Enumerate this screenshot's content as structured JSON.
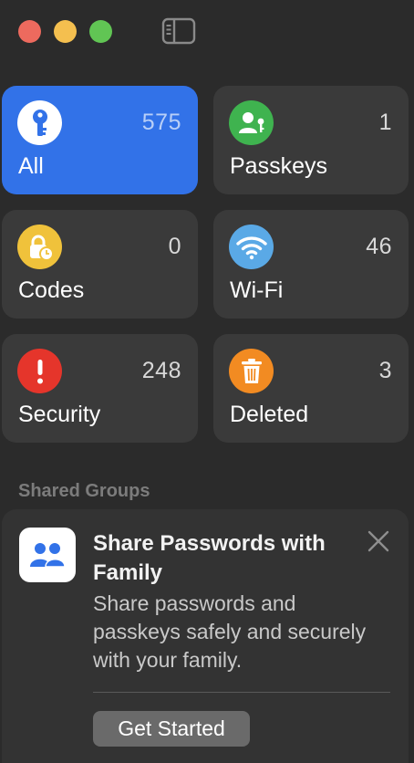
{
  "window": {
    "traffic_lights": [
      {
        "name": "close",
        "color": "#ed6a5e"
      },
      {
        "name": "minimize",
        "color": "#f4bf4f"
      },
      {
        "name": "zoom",
        "color": "#61c554"
      }
    ],
    "sidebar_toggle_icon": "sidebar-icon"
  },
  "categories": [
    {
      "id": "all",
      "label": "All",
      "count": "575",
      "icon": "key-icon",
      "icon_color": "#ffffff",
      "selected": true
    },
    {
      "id": "passkeys",
      "label": "Passkeys",
      "count": "1",
      "icon": "person-key-icon",
      "icon_color": "#3fb34f",
      "selected": false
    },
    {
      "id": "codes",
      "label": "Codes",
      "count": "0",
      "icon": "lock-clock-icon",
      "icon_color": "#f0c23b",
      "selected": false
    },
    {
      "id": "wifi",
      "label": "Wi-Fi",
      "count": "46",
      "icon": "wifi-icon",
      "icon_color": "#5aa9e6",
      "selected": false
    },
    {
      "id": "security",
      "label": "Security",
      "count": "248",
      "icon": "exclamation-icon",
      "icon_color": "#e5352b",
      "selected": false
    },
    {
      "id": "deleted",
      "label": "Deleted",
      "count": "3",
      "icon": "trash-icon",
      "icon_color": "#f28b22",
      "selected": false
    }
  ],
  "shared_groups": {
    "section_title": "Shared Groups",
    "card": {
      "icon": "family-icon",
      "title": "Share Passwords with Family",
      "description": "Share passwords and passkeys safely and securely with your family.",
      "button_label": "Get Started",
      "close_icon": "close-icon"
    }
  },
  "colors": {
    "accent": "#3272e8",
    "tile_bg": "#3a3a3a",
    "window_bg": "#2b2b2b"
  }
}
